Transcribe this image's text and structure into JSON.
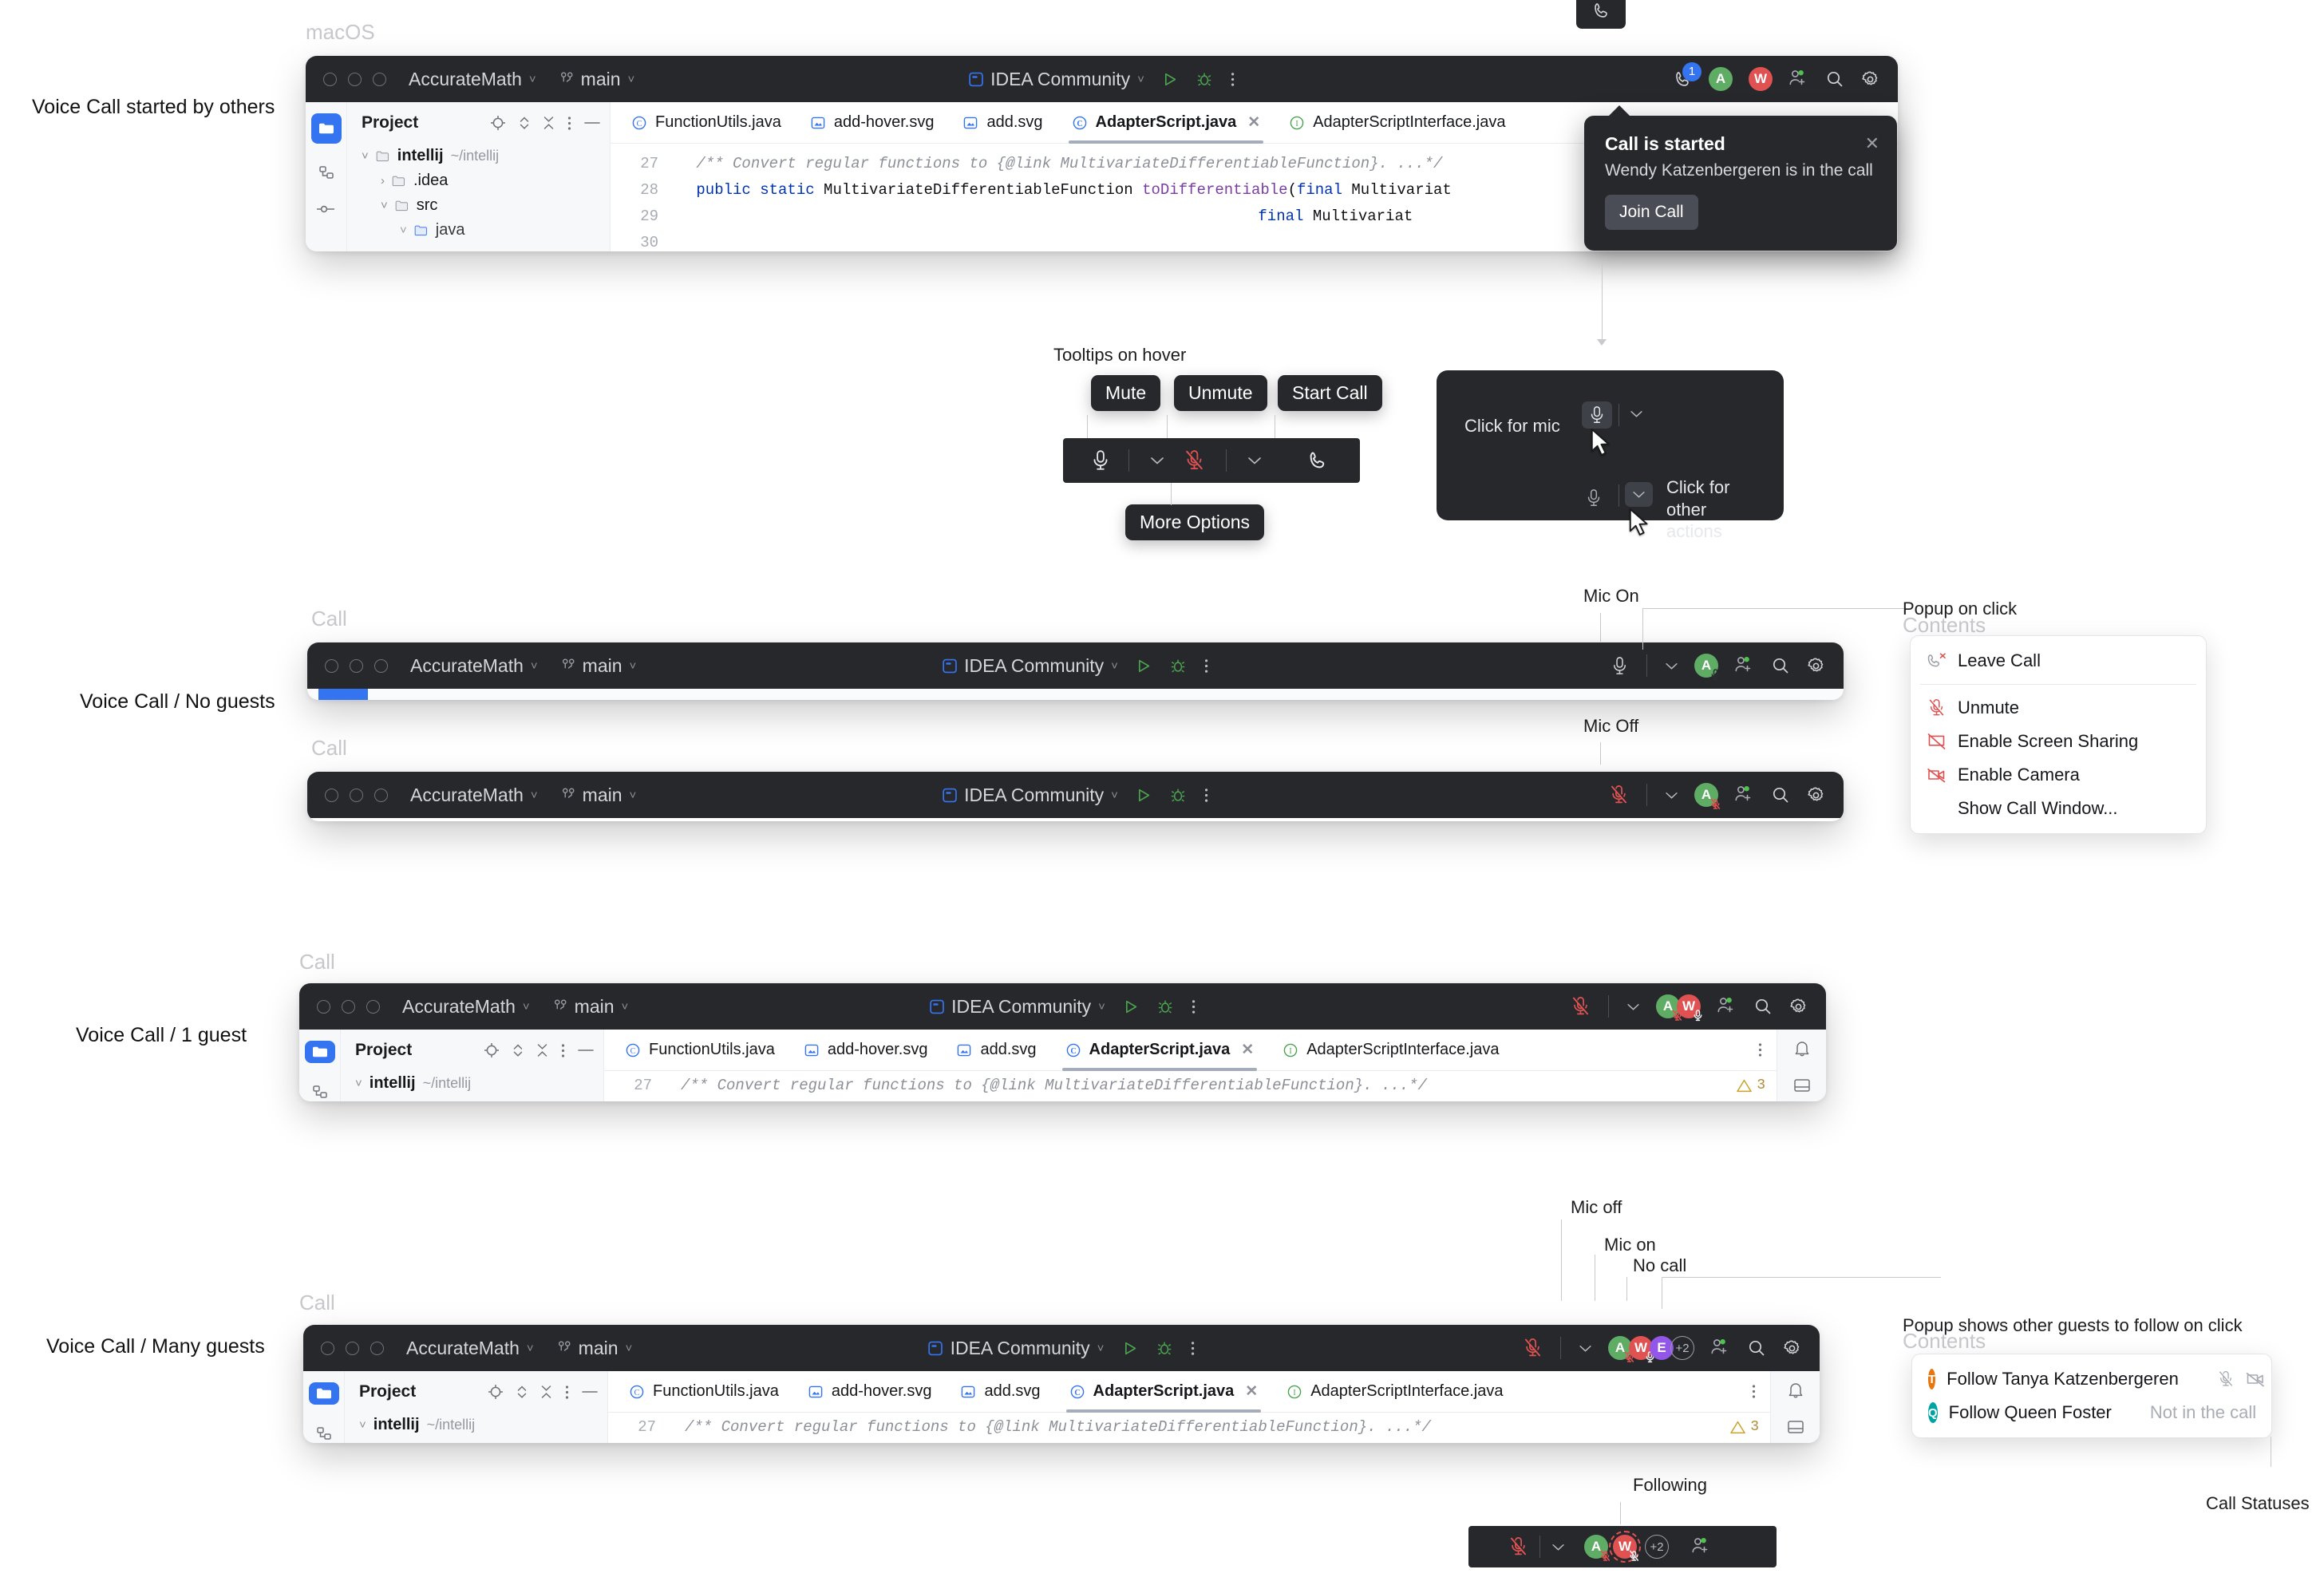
{
  "labels": {
    "macos": "macOS",
    "started_by_others": "Voice Call started by others",
    "no_guests": "Voice Call / No guests",
    "one_guest": "Voice Call  / 1 guest",
    "many_guests": "Voice Call / Many guests",
    "call_1": "Call",
    "call_2": "Call",
    "call_3": "Call",
    "call_4": "Call",
    "tooltips_on_hover": "Tooltips on hover",
    "mic_on": "Mic On",
    "mic_off": "Mic Off",
    "popup_on_click": "Popup on click",
    "contents_1": "Contents",
    "contents_2": "Contents",
    "mic_off_low": "Mic off",
    "mic_on_low": "Mic on",
    "no_call": "No call",
    "popup_follow": "Popup shows other guests to follow on click",
    "call_statuses": "Call Statuses",
    "following": "Following"
  },
  "titlebar": {
    "project": "AccurateMath",
    "branch": "main",
    "run_config": "IDEA Community"
  },
  "project_pane": {
    "title": "Project",
    "tree": [
      {
        "name": "intellij",
        "path": "~/intellij",
        "arrow": "chevron-down"
      },
      {
        "name": ".idea",
        "path": "",
        "arrow": "chevron-right"
      },
      {
        "name": "src",
        "path": "",
        "arrow": "chevron-down"
      },
      {
        "name": "java",
        "path": "",
        "arrow": "chevron-down"
      }
    ]
  },
  "editor": {
    "tabs": [
      {
        "label": "FunctionUtils.java",
        "icon": "class-icon",
        "active": false
      },
      {
        "label": "add-hover.svg",
        "icon": "svg-icon",
        "active": false
      },
      {
        "label": "add.svg",
        "icon": "svg-icon",
        "active": false
      },
      {
        "label": "AdapterScript.java",
        "icon": "class-icon",
        "active": true
      },
      {
        "label": "AdapterScriptInterface.java",
        "icon": "interface-icon",
        "active": false
      }
    ],
    "lines": [
      {
        "no": "27",
        "text": "/** Convert regular functions to {@link MultivariateDifferentiableFunction}. ...*/"
      },
      {
        "no": "28",
        "text": "public static MultivariateDifferentiableFunction toDifferentiable(final Multivariat"
      },
      {
        "no": "29",
        "text": "final Multivariat"
      },
      {
        "no": "30",
        "text": ""
      }
    ],
    "warning_count": "3"
  },
  "notification": {
    "title": "Call is started",
    "body": "Wendy Katzenbergeren is in the call",
    "join_label": "Join Call",
    "badge": "1"
  },
  "tooltips": {
    "mute": "Mute",
    "unmute": "Unmute",
    "start_call": "Start Call",
    "more_options": "More Options"
  },
  "hover_panel": {
    "click_for_mic": "Click for mic",
    "click_for_other_actions": "Click for other\nactions"
  },
  "call_menu": {
    "items": [
      {
        "label": "Leave Call",
        "icon": "phone-hangup-icon"
      },
      {
        "label": "Unmute",
        "icon": "mic-off-icon"
      },
      {
        "label": "Enable Screen Sharing",
        "icon": "screen-share-off-icon"
      },
      {
        "label": "Enable Camera",
        "icon": "camera-off-icon"
      },
      {
        "label": "Show Call Window...",
        "icon": "none"
      }
    ]
  },
  "follow_menu": {
    "items": [
      {
        "label": "Follow Tanya Katzenbergeren",
        "initial": "T",
        "color": "#e8760f",
        "status": "",
        "icons": [
          "mic-off-icon",
          "camera-off-icon"
        ]
      },
      {
        "label": "Follow Queen Foster",
        "initial": "Q",
        "color": "#00a3a3",
        "status": "Not in the call",
        "icons": []
      }
    ]
  },
  "participants": {
    "a": {
      "initial": "A",
      "color": "#5fad65"
    },
    "w": {
      "initial": "W",
      "color": "#e05252"
    },
    "e": {
      "initial": "E",
      "color": "#9257e8"
    },
    "more": "+2"
  },
  "colors": {
    "accent_blue": "#3574f0",
    "mic_red": "#e05252",
    "run_green": "#4ba34f",
    "titlebar_dark": "#27282c"
  }
}
